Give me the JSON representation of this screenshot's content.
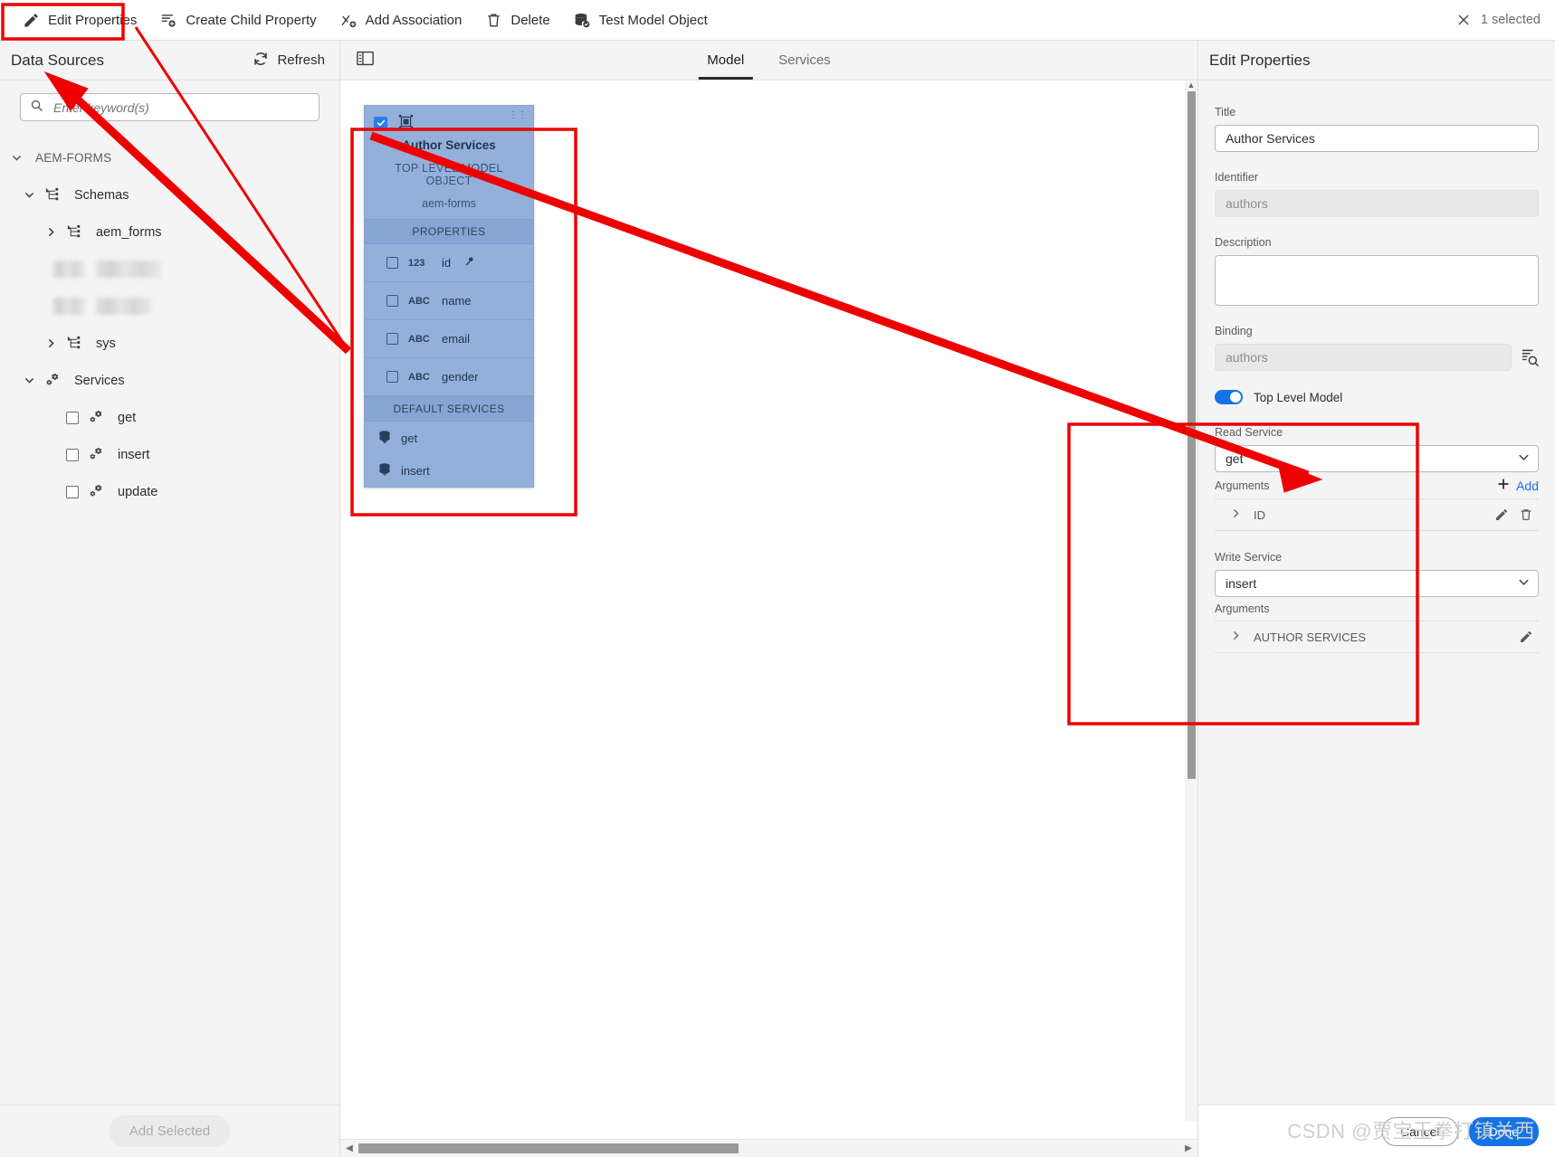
{
  "toolbar": {
    "items": [
      {
        "label": "Edit Properties",
        "icon": "pencil-icon",
        "highlighted": true
      },
      {
        "label": "Create Child Property",
        "icon": "create-child-icon"
      },
      {
        "label": "Add Association",
        "icon": "add-association-icon"
      },
      {
        "label": "Delete",
        "icon": "trash-icon"
      },
      {
        "label": "Test Model Object",
        "icon": "test-model-icon"
      }
    ],
    "selection_label": "1 selected",
    "close_icon": "close-icon"
  },
  "left_panel": {
    "title": "Data Sources",
    "refresh_label": "Refresh",
    "refresh_icon": "refresh-icon",
    "search": {
      "placeholder": "Enter keyword(s)",
      "value": "",
      "icon": "search-icon"
    },
    "tree": [
      {
        "label": "AEM-FORMS",
        "level": 0,
        "expanded": true
      },
      {
        "label": "Schemas",
        "level": 1,
        "expanded": true,
        "icon": "schema-icon"
      },
      {
        "label": "aem_forms",
        "level": 2,
        "expanded": false,
        "icon": "schema-icon"
      },
      {
        "label": "",
        "level": 2,
        "redacted": true
      },
      {
        "label": "",
        "level": 2,
        "redacted": true
      },
      {
        "label": "sys",
        "level": 2,
        "expanded": false,
        "icon": "schema-icon"
      },
      {
        "label": "Services",
        "level": 1,
        "expanded": true,
        "icon": "gear-icon"
      },
      {
        "label": "get",
        "level": 2,
        "checkbox": true,
        "icon": "gear-icon"
      },
      {
        "label": "insert",
        "level": 2,
        "checkbox": true,
        "icon": "gear-icon"
      },
      {
        "label": "update",
        "level": 2,
        "checkbox": true,
        "icon": "gear-icon"
      }
    ],
    "add_selected_label": "Add Selected"
  },
  "center_panel": {
    "panel_toggle_icon": "panel-toggle-icon",
    "tabs": [
      {
        "label": "Model",
        "active": true
      },
      {
        "label": "Services",
        "active": false
      }
    ],
    "model_card": {
      "checked": true,
      "model_icon": "model-object-icon",
      "title": "Author Services",
      "subtitle": "TOP LEVEL MODEL OBJECT",
      "source": "aem-forms",
      "properties_header": "PROPERTIES",
      "properties": [
        {
          "type": "123",
          "name": "id",
          "key": true
        },
        {
          "type": "ABC",
          "name": "name",
          "key": false
        },
        {
          "type": "ABC",
          "name": "email",
          "key": false
        },
        {
          "type": "ABC",
          "name": "gender",
          "key": false
        }
      ],
      "services_header": "DEFAULT SERVICES",
      "services": [
        {
          "name": "get",
          "icon": "service-read-icon"
        },
        {
          "name": "insert",
          "icon": "service-write-icon"
        }
      ]
    }
  },
  "right_panel": {
    "title": "Edit Properties",
    "fields": {
      "title_label": "Title",
      "title_value": "Author Services",
      "identifier_label": "Identifier",
      "identifier_value": "authors",
      "description_label": "Description",
      "description_value": "",
      "binding_label": "Binding",
      "binding_value": "authors",
      "binding_picker_icon": "binding-picker-icon",
      "top_level_label": "Top Level Model",
      "top_level_on": true
    },
    "read_service": {
      "label": "Read Service",
      "value": "get",
      "dropdown_icon": "chevron-down-icon",
      "arguments_label": "Arguments",
      "add_label": "Add",
      "add_icon": "plus-icon",
      "rows": [
        {
          "label": "ID",
          "chevron": "chevron-right-icon",
          "edit_icon": "pencil-icon",
          "delete_icon": "trash-icon"
        }
      ]
    },
    "write_service": {
      "label": "Write Service",
      "value": "insert",
      "dropdown_icon": "chevron-down-icon",
      "arguments_label": "Arguments",
      "rows": [
        {
          "label": "AUTHOR SERVICES",
          "chevron": "chevron-right-icon",
          "edit_icon": "pencil-icon"
        }
      ]
    },
    "footer": {
      "cancel_label": "Cancel",
      "done_label": "Done"
    }
  },
  "watermark": "CSDN @贾宝玉拳打镇关西",
  "colors": {
    "accent": "#1473e6",
    "annotation": "#ee0000",
    "card": "#93b0db"
  }
}
